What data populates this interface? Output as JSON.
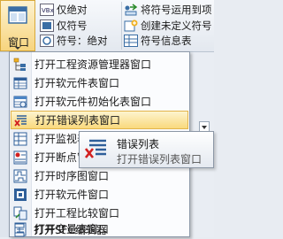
{
  "ribbon": {
    "window_button_label": "窗口",
    "items": [
      {
        "label": "仅绝对",
        "icon": "abs-only-icon"
      },
      {
        "label": "将符号运用到项",
        "icon": "apply-symbol-icon"
      },
      {
        "label": "仅符号",
        "icon": "symbol-only-icon"
      },
      {
        "label": "创建未定义符号",
        "icon": "create-undefined-symbol-icon"
      },
      {
        "label": "符号：绝对",
        "icon": "symbol-absolute-icon"
      },
      {
        "label": "符号信息表",
        "icon": "symbol-info-table-icon"
      }
    ]
  },
  "menu": {
    "items": [
      {
        "label": "打开工程资源管理器窗口",
        "icon": "project-explorer-icon"
      },
      {
        "label": "打开软元件表窗口",
        "icon": "device-table-icon"
      },
      {
        "label": "打开软元件初始化表窗口",
        "icon": "device-init-table-icon"
      },
      {
        "label": "打开错误列表窗口",
        "icon": "error-list-icon"
      },
      {
        "label": "打开监视表窗口",
        "icon": "watch-table-icon"
      },
      {
        "label": "打开断点窗口",
        "icon": "breakpoint-icon"
      },
      {
        "label": "打开时序图窗口",
        "icon": "timing-chart-icon"
      },
      {
        "label": "打开软元件窗口",
        "icon": "device-window-icon"
      },
      {
        "label": "打开工程比较窗口",
        "icon": "project-compare-icon"
      },
      {
        "label": "打开变量表窗口",
        "icon": "variable-table-icon"
      },
      {
        "label": "打开SFC编辑器",
        "icon": "sfc-editor-icon"
      }
    ],
    "highlighted_index": 3
  },
  "tooltip": {
    "title": "错误列表",
    "description": "打开错误列表窗口",
    "icon": "error-list-icon"
  },
  "colors": {
    "highlight": "#f9d97d",
    "highlight_border": "#e3b44a",
    "error_red": "#d22020"
  }
}
